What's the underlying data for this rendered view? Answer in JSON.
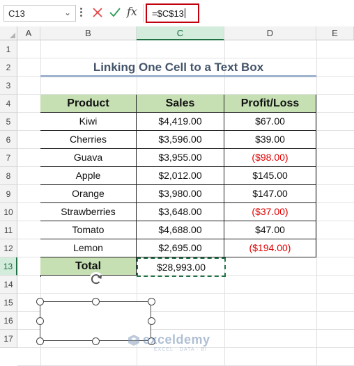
{
  "formula_bar": {
    "name_box": "C13",
    "formula": "=$C$13",
    "fx_label": "fx",
    "cancel_icon": "close-icon",
    "enter_icon": "check-icon"
  },
  "columns": [
    "A",
    "B",
    "C",
    "D",
    "E"
  ],
  "active_column": "C",
  "rows": [
    "1",
    "2",
    "3",
    "4",
    "5",
    "6",
    "7",
    "8",
    "9",
    "10",
    "11",
    "12",
    "13",
    "14",
    "15",
    "16",
    "17"
  ],
  "active_row": "13",
  "sheet": {
    "title": "Linking One Cell to a Text Box",
    "headers": {
      "product": "Product",
      "sales": "Sales",
      "profit": "Profit/Loss"
    },
    "data": [
      {
        "product": "Kiwi",
        "sales": "$4,419.00",
        "profit": "$67.00",
        "negative": false
      },
      {
        "product": "Cherries",
        "sales": "$3,596.00",
        "profit": "$39.00",
        "negative": false
      },
      {
        "product": "Guava",
        "sales": "$3,955.00",
        "profit": "($98.00)",
        "negative": true
      },
      {
        "product": "Apple",
        "sales": "$2,012.00",
        "profit": "$145.00",
        "negative": false
      },
      {
        "product": "Orange",
        "sales": "$3,980.00",
        "profit": "$147.00",
        "negative": false
      },
      {
        "product": "Strawberries",
        "sales": "$3,648.00",
        "profit": "($37.00)",
        "negative": true
      },
      {
        "product": "Tomato",
        "sales": "$4,688.00",
        "profit": "$47.00",
        "negative": false
      },
      {
        "product": "Lemon",
        "sales": "$2,695.00",
        "profit": "($194.00)",
        "negative": true
      }
    ],
    "total_label": "Total",
    "total_value": "$28,993.00"
  },
  "colors": {
    "header_fill": "#c6e0b4",
    "negative_text": "#e00000",
    "title_text": "#44546a",
    "selection": "#217346",
    "formula_highlight": "#c0000c"
  },
  "watermark": {
    "name": "exceldemy",
    "tagline": "EXCEL · DATA · BI"
  }
}
